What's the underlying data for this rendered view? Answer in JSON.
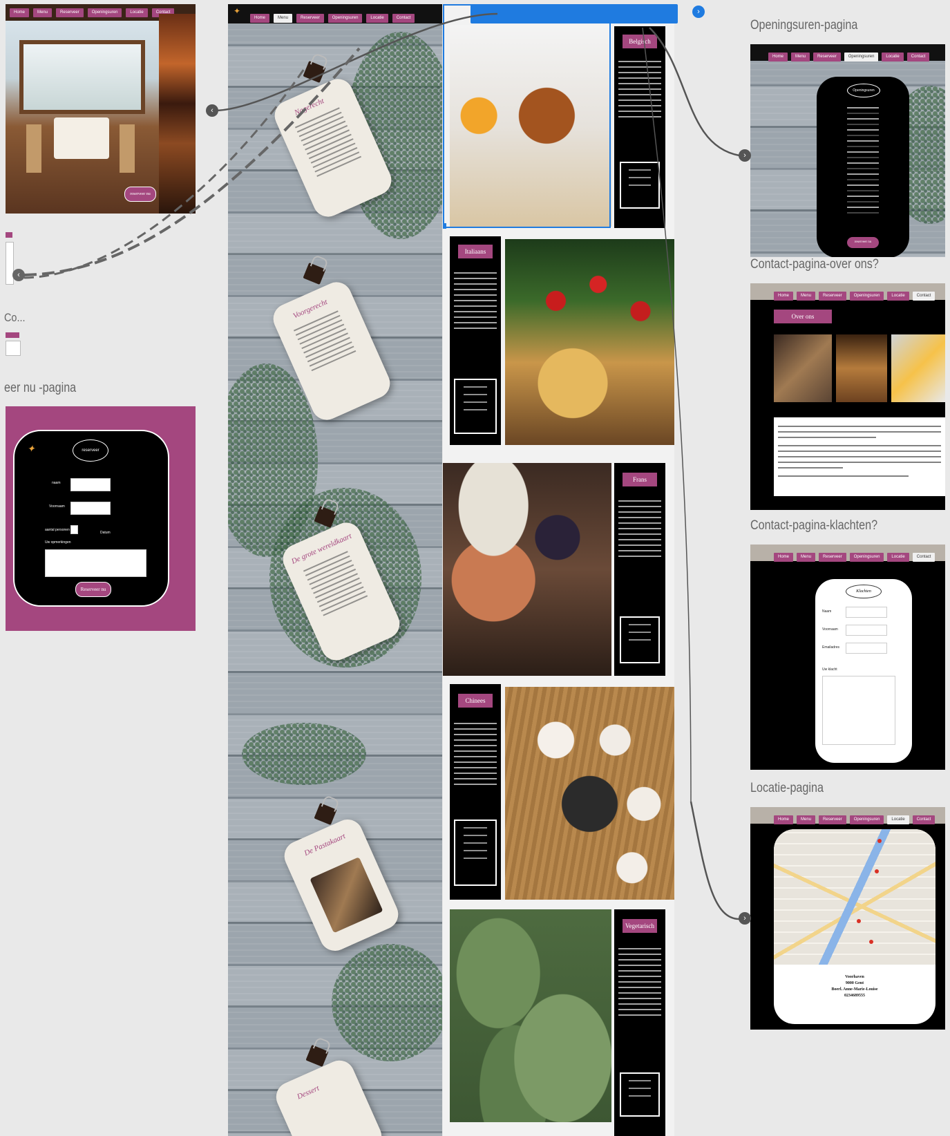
{
  "canvas": {
    "artboard_labels": {
      "openingsuren": "Openingsuren-pagina",
      "contact_over_ons": "Contact-pagina-over ons?",
      "contact_klachten": "Contact-pagina-klachten?",
      "locatie": "Locatie-pagina",
      "reserveer": "eer nu -pagina",
      "partial_co": "Co..."
    }
  },
  "nav_tabs": [
    "Home",
    "Menu",
    "Reserveer",
    "Openingsuren",
    "Locatie",
    "Contact"
  ],
  "home": {
    "reserve_button": "reserveer nu"
  },
  "menu_cards": [
    {
      "title": "Nagerecht"
    },
    {
      "title": "Voorgerecht"
    },
    {
      "title": "De grote wereldkaart"
    },
    {
      "title": "De Pastakaart"
    },
    {
      "title": "Dessert"
    }
  ],
  "cuisines": [
    {
      "name": "Belgisch",
      "photo": "burger-and-beer-photo"
    },
    {
      "name": "Italiaans",
      "photo": "pasta-and-tomatoes-photo"
    },
    {
      "name": "Frans",
      "photo": "cheese-and-grapes-photo"
    },
    {
      "name": "Chinees",
      "photo": "asian-bowls-photo"
    },
    {
      "name": "Vegetarisch",
      "photo": "cabbage-leaves-photo"
    }
  ],
  "openingsuren": {
    "title": "Openingsuren",
    "button": "reserveer nu"
  },
  "over_ons": {
    "title": "Over ons"
  },
  "klachten": {
    "title": "Klachten",
    "fields": [
      "Naam",
      "Voornaam",
      "Emailadres",
      "Uw klacht"
    ]
  },
  "locatie": {
    "address": [
      "Voorhaven",
      "9000 Gent",
      "Boerl. Anne-Marie-Louise",
      "0234689555"
    ]
  },
  "reserveer": {
    "title": "reserveer",
    "fields": [
      "naam",
      "Voornaam",
      "aantal personen",
      "Datum"
    ],
    "remark_label": "Uw opmerkingen",
    "button": "Reserveer nu"
  },
  "colors": {
    "accent": "#a4477f",
    "selection": "#1f7be0",
    "canvas": "#e9e9e9"
  }
}
